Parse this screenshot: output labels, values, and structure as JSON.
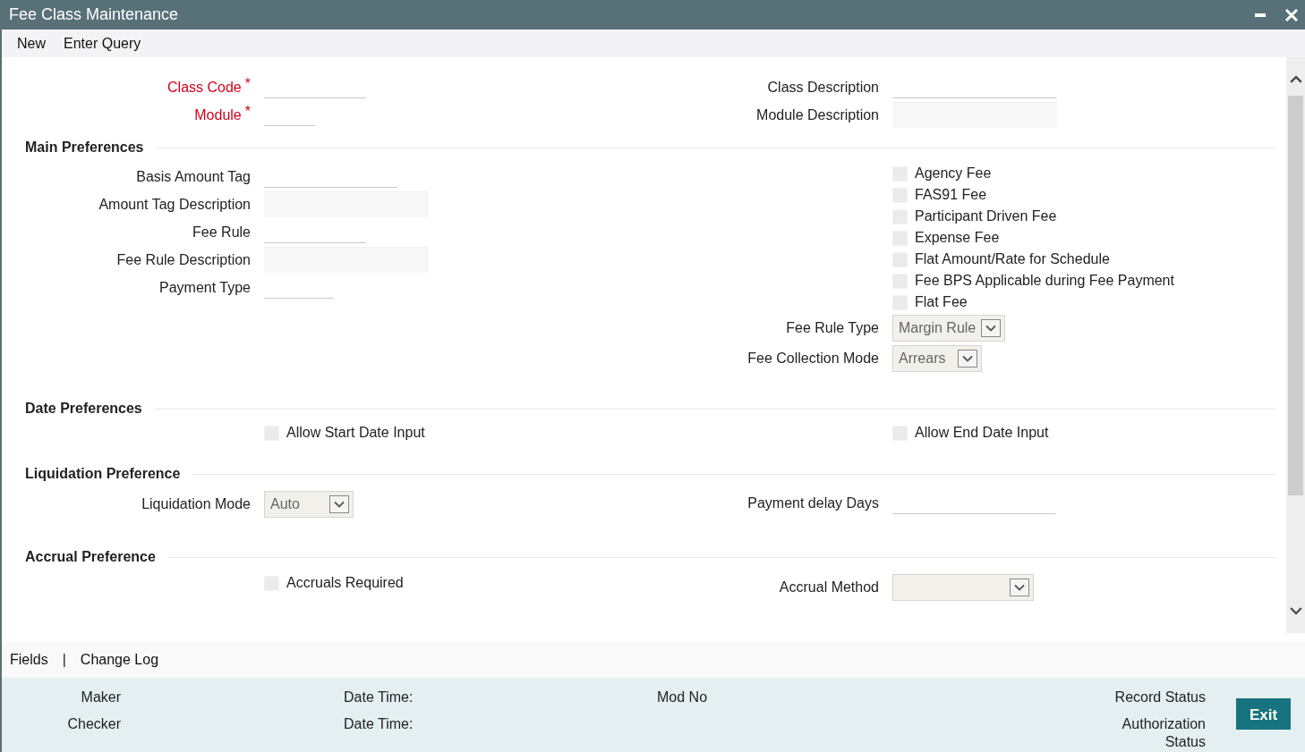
{
  "window": {
    "title": "Fee Class Maintenance"
  },
  "toolbar": [
    {
      "label": "New"
    },
    {
      "label": "Enter Query"
    }
  ],
  "header": {
    "left": [
      {
        "kind": "input",
        "label": "Class Code",
        "required": true,
        "required_mark": "*"
      },
      {
        "kind": "input",
        "label": "Module",
        "required": true,
        "required_mark": "*"
      }
    ],
    "right": [
      {
        "kind": "input",
        "label": "Class Description",
        "required": false
      },
      {
        "kind": "display",
        "label": "Module Description",
        "required": false
      }
    ]
  },
  "sections": [
    {
      "title": "Main Preferences",
      "left": [
        {
          "kind": "input",
          "label": "Basis Amount Tag"
        },
        {
          "kind": "display",
          "label": "Amount Tag Description"
        },
        {
          "kind": "input",
          "label": "Fee Rule"
        },
        {
          "kind": "display",
          "label": "Fee Rule Description"
        },
        {
          "kind": "input",
          "label": "Payment Type"
        }
      ],
      "right": [
        {
          "kind": "checkbox",
          "label": "Agency Fee",
          "checked": false
        },
        {
          "kind": "checkbox",
          "label": "FAS91 Fee",
          "checked": false
        },
        {
          "kind": "checkbox",
          "label": "Participant Driven Fee",
          "checked": false
        },
        {
          "kind": "checkbox",
          "label": "Expense Fee",
          "checked": false
        },
        {
          "kind": "checkbox",
          "label": "Flat Amount/Rate for Schedule",
          "checked": false
        },
        {
          "kind": "checkbox",
          "label": "Fee BPS Applicable during Fee Payment",
          "checked": false
        },
        {
          "kind": "checkbox",
          "label": "Flat Fee",
          "checked": false
        },
        {
          "kind": "select",
          "label": "Fee Rule Type",
          "value": "Margin Rule"
        },
        {
          "kind": "select",
          "label": "Fee Collection Mode",
          "value": "Arrears"
        }
      ]
    },
    {
      "title": "Date Preferences",
      "left": [
        {
          "kind": "checkbox",
          "label": "Allow Start Date Input",
          "checked": false
        }
      ],
      "right": [
        {
          "kind": "checkbox",
          "label": "Allow End Date Input",
          "checked": false
        }
      ]
    },
    {
      "title": "Liquidation Preference",
      "left": [
        {
          "kind": "select",
          "label": "Liquidation Mode",
          "value": "Auto"
        }
      ],
      "right": [
        {
          "kind": "input",
          "label": "Payment delay Days"
        }
      ]
    },
    {
      "title": "Accrual Preference",
      "left": [
        {
          "kind": "checkbox",
          "label": "Accruals Required",
          "checked": false
        }
      ],
      "right": [
        {
          "kind": "select",
          "label": "Accrual Method"
        }
      ]
    }
  ],
  "footer": {
    "links": [
      "Fields",
      "Change Log"
    ],
    "separator": "|"
  },
  "audit": {
    "columns": [
      [
        "Maker",
        "Checker"
      ],
      [
        "Date Time:",
        "Date Time:"
      ],
      [
        "Mod No"
      ],
      [
        "Record Status",
        "Authorization Status"
      ]
    ]
  },
  "exit_button": {
    "label": "Exit"
  }
}
